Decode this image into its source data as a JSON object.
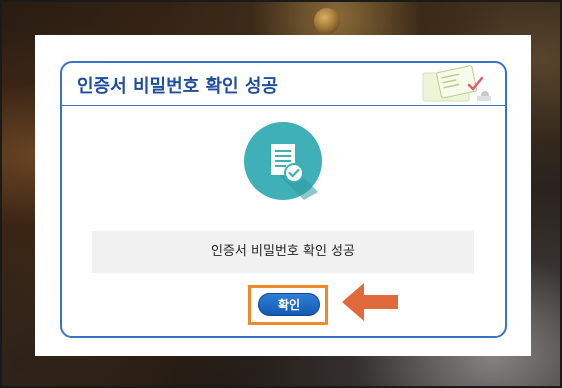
{
  "dialog": {
    "title": "인증서 비밀번호 확인 성공",
    "message": "인증서 비밀번호 확인 성공",
    "ok_label": "확인"
  },
  "icons": {
    "status": "document-check-icon",
    "decoration": "certificate-decoration-icon",
    "pointer": "arrow-left-icon"
  },
  "colors": {
    "border": "#3a73c4",
    "title": "#1f4e9e",
    "icon_bg": "#3fb0b7",
    "highlight": "#ef8a2b",
    "button": "#1f6cc9"
  }
}
